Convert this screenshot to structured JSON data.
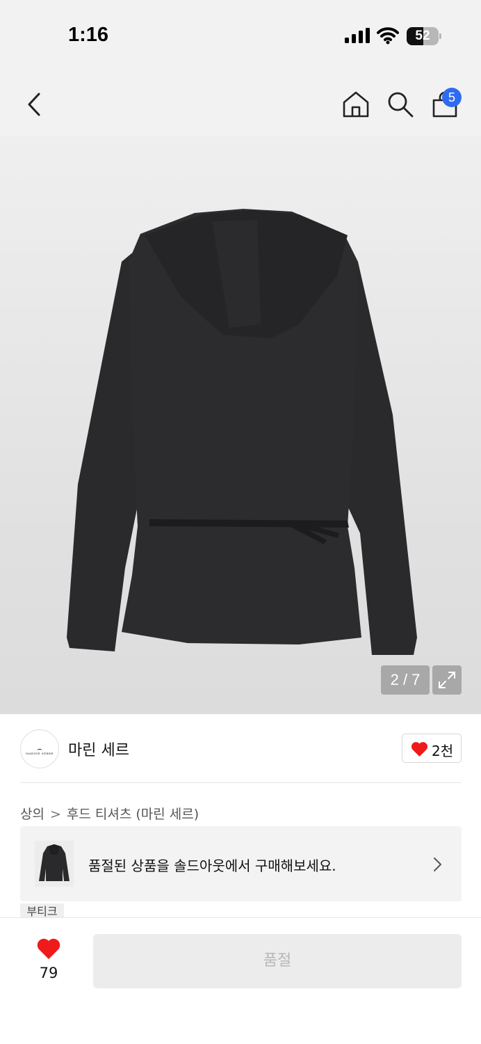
{
  "status_bar": {
    "time": "1:16",
    "battery_percent": 52,
    "battery_label": "52"
  },
  "nav": {
    "cart_count": "5"
  },
  "gallery": {
    "counter": "2 / 7",
    "current": 2,
    "total": 7
  },
  "brand": {
    "logo_text": "MARINE SERRE",
    "name": "마린 세르",
    "like_count": "2천"
  },
  "breadcrumb": {
    "category": "상의",
    "separator": ">",
    "subcategory": "후드 티셔츠 (마린 세르)"
  },
  "soldout_banner": {
    "text": "품절된 상품을 솔드아웃에서 구매해보세요."
  },
  "tag": {
    "label": "부티크"
  },
  "bottom_bar": {
    "wish_count": "79",
    "button_label": "품절"
  },
  "colors": {
    "accent_badge": "#2f6bf0",
    "heart": "#ef1b1b",
    "disabled_text": "#b7b7b7"
  }
}
